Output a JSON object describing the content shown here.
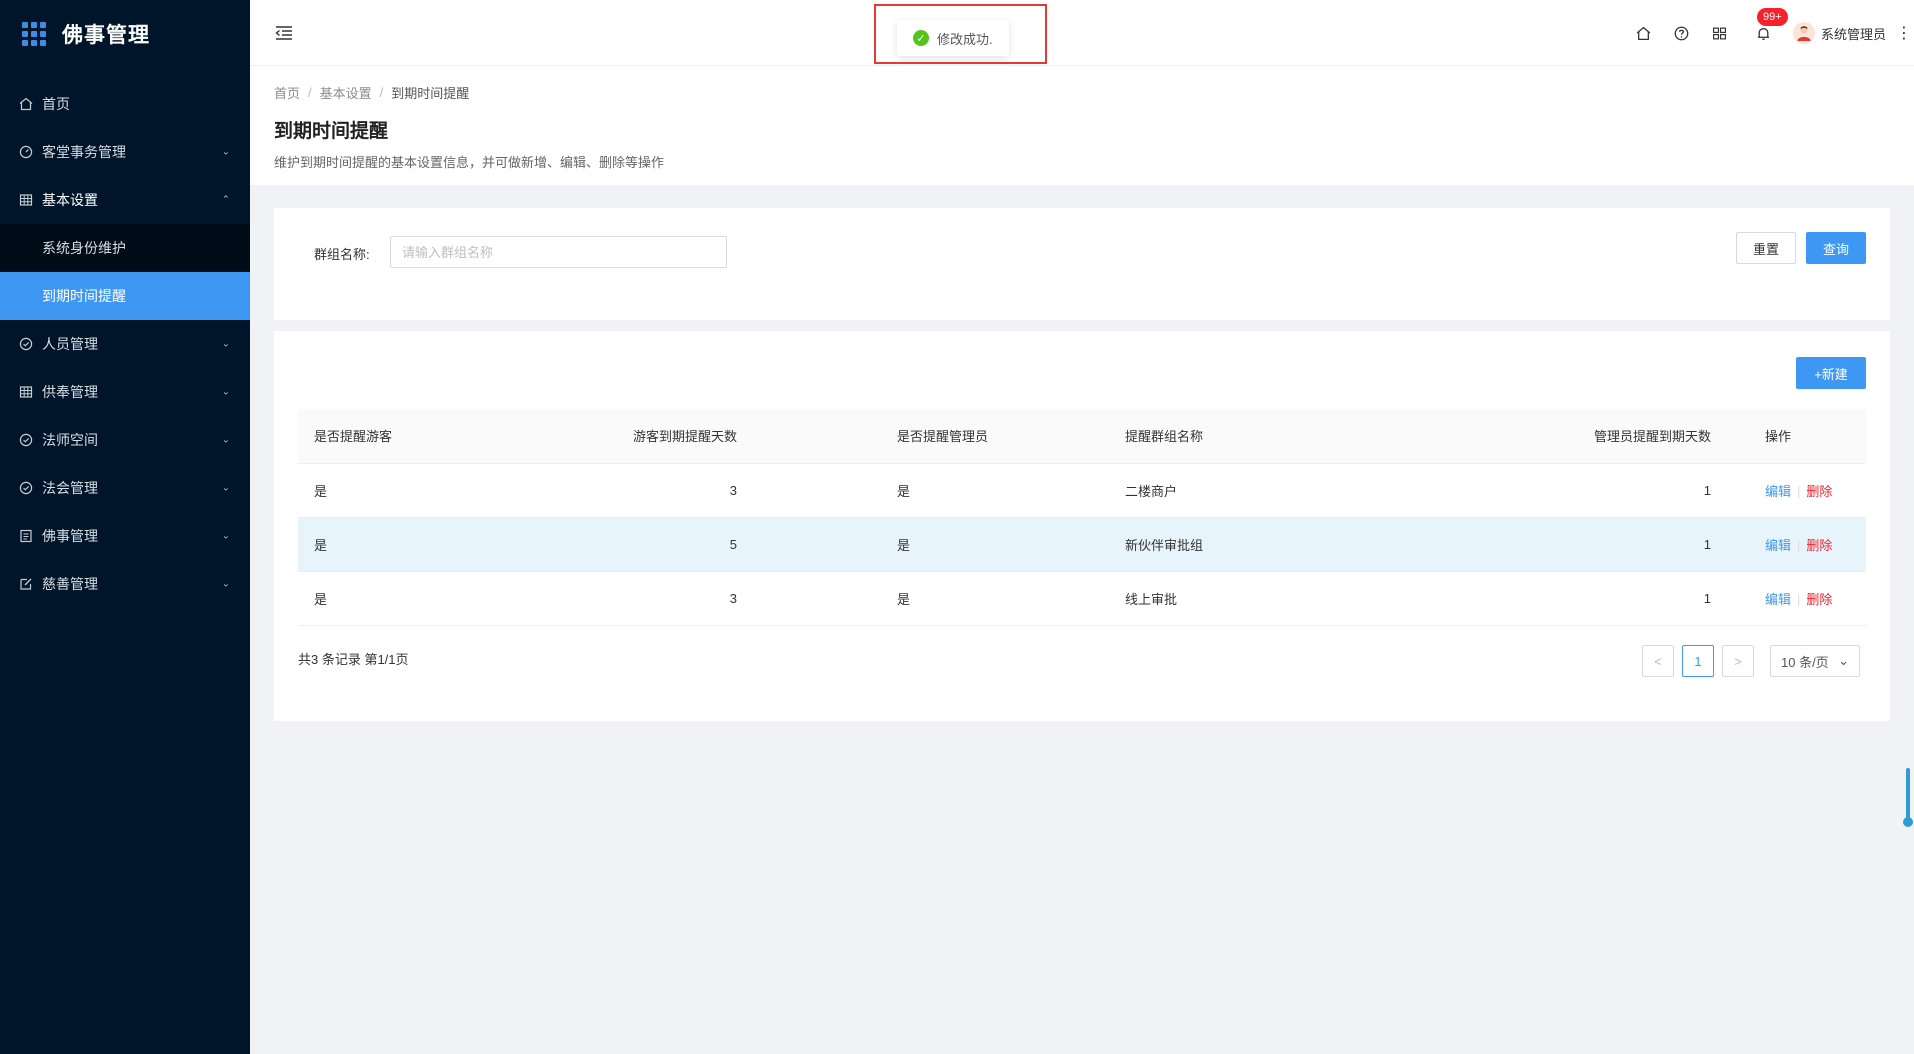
{
  "app": {
    "title": "佛事管理"
  },
  "sidebar": {
    "items": [
      {
        "label": "首页",
        "icon": "home-icon",
        "arrow": ""
      },
      {
        "label": "客堂事务管理",
        "icon": "dashboard-icon",
        "arrow": "⌄"
      },
      {
        "label": "基本设置",
        "icon": "table-icon",
        "arrow": "⌃"
      },
      {
        "label": "人员管理",
        "icon": "check-circle-icon",
        "arrow": "⌄"
      },
      {
        "label": "供奉管理",
        "icon": "table-icon",
        "arrow": "⌄"
      },
      {
        "label": "法师空间",
        "icon": "check-circle-icon",
        "arrow": "⌄"
      },
      {
        "label": "法会管理",
        "icon": "check-circle-icon",
        "arrow": "⌄"
      },
      {
        "label": "佛事管理",
        "icon": "list-icon",
        "arrow": "⌄"
      },
      {
        "label": "慈善管理",
        "icon": "edit-icon",
        "arrow": "⌄"
      }
    ],
    "submenu": [
      {
        "label": "系统身份维护"
      },
      {
        "label": "到期时间提醒"
      }
    ]
  },
  "header": {
    "badge": "99+",
    "user_name": "系统管理员",
    "more": "⋮"
  },
  "toast": {
    "message": "修改成功."
  },
  "page": {
    "breadcrumb": [
      "首页",
      "基本设置",
      "到期时间提醒"
    ],
    "breadcrumb_sep": "/",
    "title": "到期时间提醒",
    "description": "维护到期时间提醒的基本设置信息，并可做新增、编辑、删除等操作"
  },
  "filter": {
    "label": "群组名称:",
    "placeholder": "请输入群组名称",
    "reset_label": "重置",
    "search_label": "查询"
  },
  "table": {
    "new_label": "+新建",
    "columns": [
      "是否提醒游客",
      "游客到期提醒天数",
      "是否提醒管理员",
      "提醒群组名称",
      "管理员提醒到期天数",
      "操作"
    ],
    "rows": [
      [
        "是",
        "3",
        "是",
        "二楼商户",
        "1"
      ],
      [
        "是",
        "5",
        "是",
        "新伙伴审批组",
        "1"
      ],
      [
        "是",
        "3",
        "是",
        "线上审批",
        "1"
      ]
    ],
    "edit_label": "编辑",
    "delete_label": "删除",
    "op_sep": "|"
  },
  "pagination": {
    "total_text": "共3 条记录 第1/1页",
    "prev": "<",
    "next": ">",
    "current_page": "1",
    "page_size": "10 条/页",
    "page_size_arrow": "⌄"
  },
  "colors": {
    "accent": "#3e98f3",
    "sidebar_bg": "#001529",
    "danger": "#f5222d",
    "success": "#52c41a"
  }
}
